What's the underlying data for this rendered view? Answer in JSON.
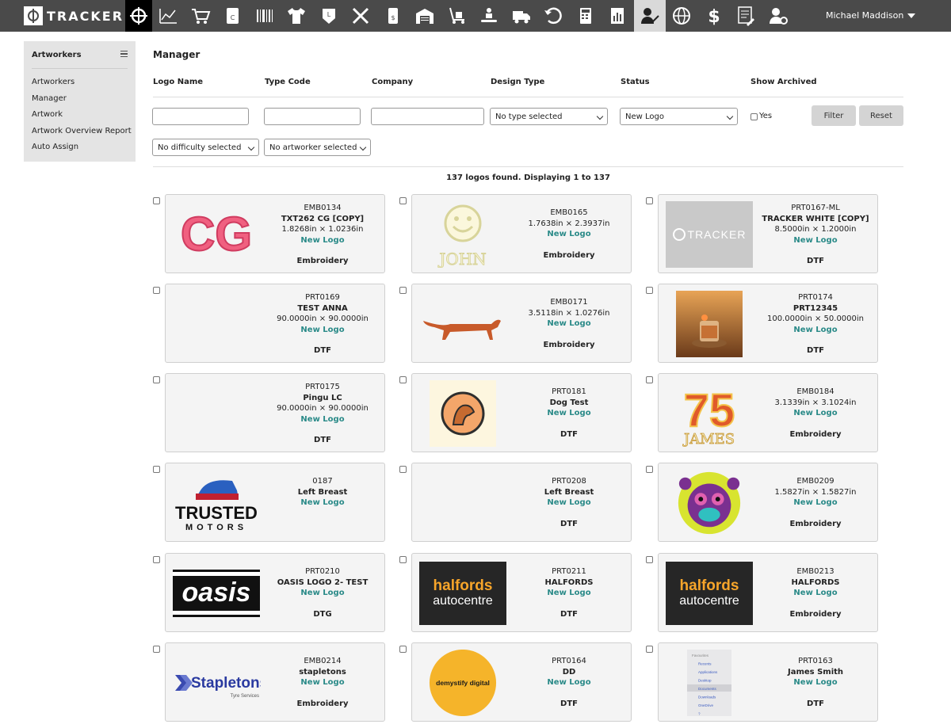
{
  "brand": {
    "name": "TRACKER"
  },
  "nav_icons": [
    "crosshair-icon",
    "chart-icon",
    "cart-icon",
    "contacts-icon",
    "barcode-icon",
    "shirt-icon",
    "badge-icon",
    "tools-icon",
    "price-tag-icon",
    "warehouse-icon",
    "trolley-icon",
    "conveyor-icon",
    "truck-icon",
    "returns-icon",
    "calculator-icon",
    "report-icon",
    "artworker-icon",
    "globe-icon",
    "dollar-icon",
    "document-icon",
    "user-settings-icon"
  ],
  "user": {
    "name": "Michael Maddison"
  },
  "sidebar": {
    "title": "Artworkers",
    "items": [
      {
        "label": "Artworkers"
      },
      {
        "label": "Manager"
      },
      {
        "label": "Artwork"
      },
      {
        "label": "Artwork Overview Report"
      },
      {
        "label": "Auto Assign"
      }
    ]
  },
  "page": {
    "title": "Manager"
  },
  "filters": {
    "labels": {
      "logo_name": "Logo Name",
      "type_code": "Type Code",
      "company": "Company",
      "design_type": "Design Type",
      "status": "Status",
      "show_archived": "Show Archived"
    },
    "logo_name_value": "",
    "type_code_value": "",
    "company_value": "",
    "design_type_selected": "No type selected",
    "status_selected": "New Logo",
    "archived_label": "Yes",
    "difficulty_selected": "No difficulty selected",
    "artworker_selected": "No artworker selected",
    "filter_button": "Filter",
    "reset_button": "Reset"
  },
  "results": {
    "summary": "137 logos found. Displaying 1 to 137"
  },
  "logos": [
    {
      "code": "EMB0134",
      "name": "TXT262 CG [COPY]",
      "size": "1.8268in × 1.0236in",
      "status": "New Logo",
      "type": "Embroidery",
      "thumb_text": "CG"
    },
    {
      "code": "EMB0165",
      "name": "",
      "size": "1.7638in × 2.3937in",
      "status": "New Logo",
      "type": "Embroidery",
      "thumb_text": "JOHN"
    },
    {
      "code": "PRT0167-ML",
      "name": "TRACKER WHITE [COPY]",
      "size": "8.5000in × 1.2000in",
      "status": "New Logo",
      "type": "DTF",
      "thumb_text": "TRACKER"
    },
    {
      "code": "PRT0169",
      "name": "TEST ANNA",
      "size": "90.0000in × 90.0000in",
      "status": "New Logo",
      "type": "DTF",
      "thumb_text": ""
    },
    {
      "code": "EMB0171",
      "name": "",
      "size": "3.5118in × 1.0276in",
      "status": "New Logo",
      "type": "Embroidery",
      "thumb_text": ""
    },
    {
      "code": "PRT0174",
      "name": "PRT12345",
      "size": "100.0000in × 50.0000in",
      "status": "New Logo",
      "type": "DTF",
      "thumb_text": ""
    },
    {
      "code": "PRT0175",
      "name": "Pingu LC",
      "size": "90.0000in × 90.0000in",
      "status": "New Logo",
      "type": "DTF",
      "thumb_text": ""
    },
    {
      "code": "PRT0181",
      "name": "Dog Test",
      "size": "",
      "status": "New Logo",
      "type": "DTF",
      "thumb_text": ""
    },
    {
      "code": "EMB0184",
      "name": "",
      "size": "3.1339in × 3.1024in",
      "status": "New Logo",
      "type": "Embroidery",
      "thumb_text": "75",
      "thumb_text2": "JAMES"
    },
    {
      "code": "0187",
      "name": "Left Breast",
      "size": "",
      "status": "New Logo",
      "type": "",
      "thumb_text": "TRUSTED",
      "thumb_text2": "MOTORS"
    },
    {
      "code": "PRT0208",
      "name": "Left Breast",
      "size": "",
      "status": "New Logo",
      "type": "DTF",
      "thumb_text": ""
    },
    {
      "code": "EMB0209",
      "name": "",
      "size": "1.5827in × 1.5827in",
      "status": "New Logo",
      "type": "Embroidery",
      "thumb_text": ""
    },
    {
      "code": "PRT0210",
      "name": "OASIS LOGO 2- TEST",
      "size": "",
      "status": "New Logo",
      "type": "DTG",
      "thumb_text": "oasis"
    },
    {
      "code": "PRT0211",
      "name": "HALFORDS",
      "size": "",
      "status": "New Logo",
      "type": "DTF",
      "thumb_text": "halfords",
      "thumb_text2": "autocentre"
    },
    {
      "code": "EMB0213",
      "name": "HALFORDS",
      "size": "",
      "status": "New Logo",
      "type": "Embroidery",
      "thumb_text": "halfords",
      "thumb_text2": "autocentre"
    },
    {
      "code": "EMB0214",
      "name": "stapletons",
      "size": "",
      "status": "New Logo",
      "type": "Embroidery",
      "thumb_text": "Stapletons",
      "thumb_text2": "Tyre Services"
    },
    {
      "code": "PRT0164",
      "name": "DD",
      "size": "",
      "status": "New Logo",
      "type": "DTF",
      "thumb_text": "demystify digital"
    },
    {
      "code": "PRT0163",
      "name": "James Smith",
      "size": "",
      "status": "New Logo",
      "type": "DTF",
      "thumb_text": "",
      "thumb_items": [
        "Favourites",
        "Recents",
        "Applications",
        "Desktop",
        "Documents",
        "Downloads",
        "OneDrive",
        "?"
      ]
    }
  ],
  "colors": {
    "topbar": "#4a4a4a",
    "status_teal": "#2a8a88",
    "sidebar_bg": "#e4e4e4",
    "card_bg": "#f4f4f4"
  }
}
